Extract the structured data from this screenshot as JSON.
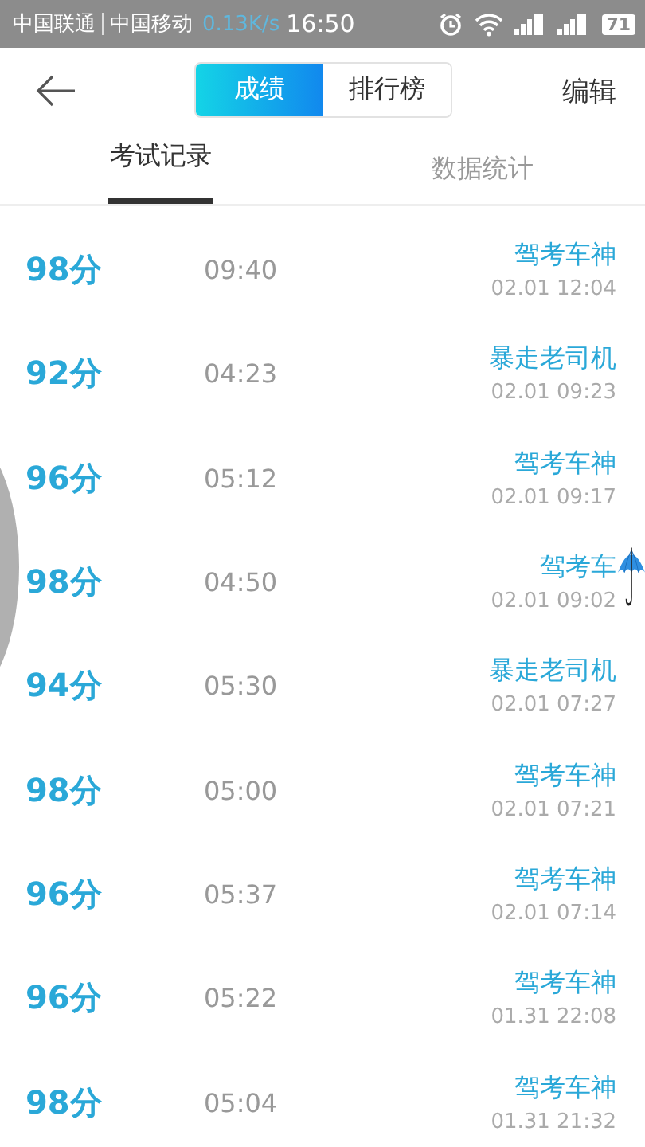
{
  "status_bar": {
    "carrier_1": "中国联通",
    "carrier_2": "中国移动",
    "speed": "0.13K/s",
    "time": "16:50",
    "battery": "71"
  },
  "header": {
    "segments": [
      {
        "label": "成绩",
        "selected": true
      },
      {
        "label": "排行榜",
        "selected": false
      }
    ],
    "action": "编辑"
  },
  "tabs": [
    {
      "label": "考试记录",
      "selected": true
    },
    {
      "label": "数据统计",
      "selected": false
    }
  ],
  "records": [
    {
      "score": "98分",
      "duration": "09:40",
      "name": "驾考车神",
      "date": "02.01  12:04"
    },
    {
      "score": "92分",
      "duration": "04:23",
      "name": "暴走老司机",
      "date": "02.01  09:23"
    },
    {
      "score": "96分",
      "duration": "05:12",
      "name": "驾考车神",
      "date": "02.01  09:17"
    },
    {
      "score": "98分",
      "duration": "04:50",
      "name": "驾考车",
      "date": "02.01  09:02"
    },
    {
      "score": "94分",
      "duration": "05:30",
      "name": "暴走老司机",
      "date": "02.01  07:27"
    },
    {
      "score": "98分",
      "duration": "05:00",
      "name": "驾考车神",
      "date": "02.01  07:21"
    },
    {
      "score": "96分",
      "duration": "05:37",
      "name": "驾考车神",
      "date": "02.01  07:14"
    },
    {
      "score": "96分",
      "duration": "05:22",
      "name": "驾考车神",
      "date": "01.31  22:08"
    },
    {
      "score": "98分",
      "duration": "05:04",
      "name": "驾考车神",
      "date": "01.31  21:32"
    }
  ]
}
